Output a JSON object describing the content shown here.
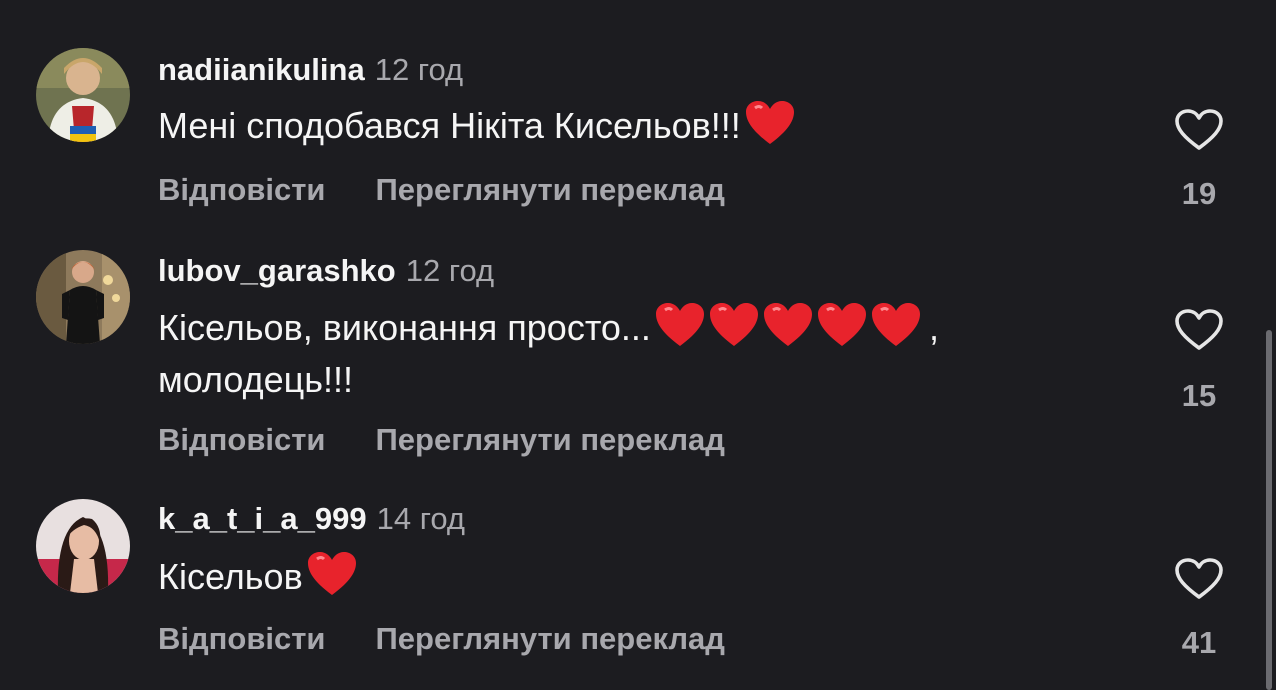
{
  "comments": [
    {
      "username": "nadiianikulina",
      "time": "12 год",
      "text": "Мені сподобався Нікіта Кисельов!!!",
      "text_suffix": "",
      "reply_label": "Відповісти",
      "translate_label": "Переглянути переклад",
      "likes": "19"
    },
    {
      "username": "lubov_garashko",
      "time": "12 год",
      "text": "Кісельов, виконання просто...",
      "text_suffix": ",",
      "text_line2": "молодець!!!",
      "reply_label": "Відповісти",
      "translate_label": "Переглянути переклад",
      "likes": "15"
    },
    {
      "username": "k_a_t_i_a_999",
      "time": "14 год",
      "text": "Кісельов",
      "text_suffix": "",
      "reply_label": "Відповісти",
      "translate_label": "Переглянути переклад",
      "likes": "41"
    }
  ],
  "icons": {
    "like": "heart-outline-icon",
    "emoji": "red-heart-emoji"
  },
  "colors": {
    "background": "#1c1c20",
    "primary_text": "#f5f5f5",
    "secondary_text": "#a8a8ad",
    "heart_emoji": "#e8232c"
  }
}
